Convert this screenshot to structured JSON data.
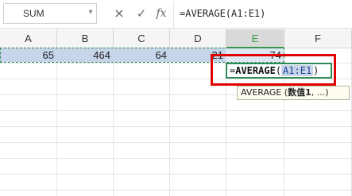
{
  "formula_bar": {
    "name_box": "SUM",
    "cancel_icon": "×",
    "enter_icon": "✓",
    "fx_label": "fx",
    "formula": "=AVERAGE(A1:E1)"
  },
  "columns": [
    "A",
    "B",
    "C",
    "D",
    "E",
    "F"
  ],
  "active_column": "E",
  "row1": {
    "values": [
      "65",
      "464",
      "64",
      "21",
      "74"
    ]
  },
  "editing": {
    "prefix": "=",
    "function": "AVERAGE",
    "open": "(",
    "reference": "A1:E1",
    "close": ")"
  },
  "tooltip": {
    "func": "AVERAGE",
    "open": " (",
    "arg": "数值1",
    "rest": ", ...)"
  },
  "colors": {
    "selection": "#c7d5ea",
    "active_border": "#2e8b57",
    "highlight": "#e00000",
    "tooltip_bg": "#fffdf0"
  }
}
